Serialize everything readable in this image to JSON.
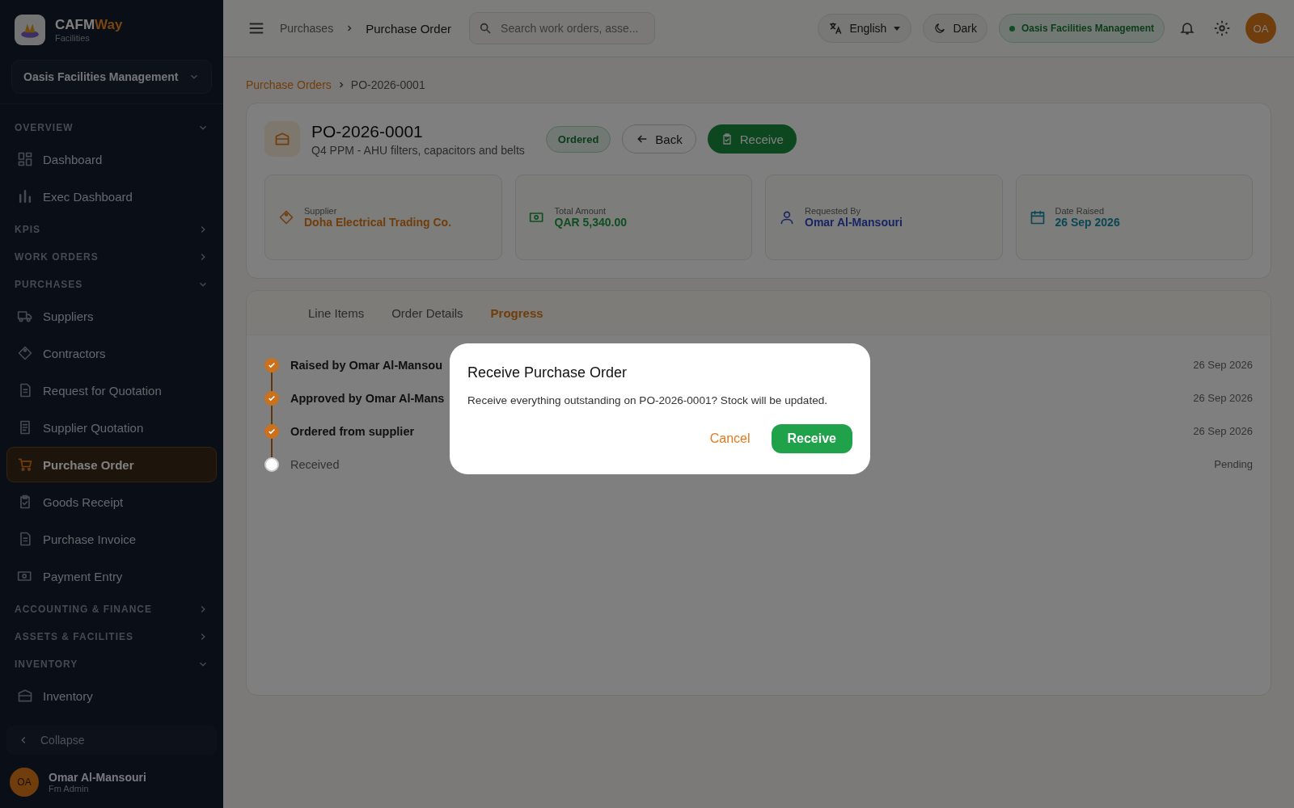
{
  "sidebar": {
    "brand": {
      "name_part1": "CAFM",
      "name_part2": "Way",
      "subtitle": "Facilities"
    },
    "org_selector": "Oasis Facilities Management",
    "sections": [
      {
        "title": "OVERVIEW",
        "expanded": true,
        "items": [
          {
            "label": "Dashboard",
            "selected": false
          },
          {
            "label": "Exec Dashboard",
            "selected": false
          }
        ]
      },
      {
        "title": "KPIS",
        "expanded": false
      },
      {
        "title": "WORK ORDERS",
        "expanded": false
      },
      {
        "title": "PURCHASES",
        "expanded": true,
        "items": [
          {
            "label": "Suppliers",
            "selected": false
          },
          {
            "label": "Contractors",
            "selected": false
          },
          {
            "label": "Request for Quotation",
            "selected": false
          },
          {
            "label": "Supplier Quotation",
            "selected": false
          },
          {
            "label": "Purchase Order",
            "selected": true
          },
          {
            "label": "Goods Receipt",
            "selected": false
          },
          {
            "label": "Purchase Invoice",
            "selected": false
          },
          {
            "label": "Payment Entry",
            "selected": false
          }
        ]
      },
      {
        "title": "ACCOUNTING & FINANCE",
        "expanded": false
      },
      {
        "title": "ASSETS & FACILITIES",
        "expanded": false
      },
      {
        "title": "INVENTORY",
        "expanded": true,
        "items": [
          {
            "label": "Inventory",
            "selected": false
          }
        ]
      }
    ],
    "collapse": "Collapse",
    "user": {
      "initials": "OA",
      "name": "Omar Al-Mansouri",
      "role": "Fm Admin"
    }
  },
  "topbar": {
    "breadcrumb": [
      "Purchases",
      "Purchase Order"
    ],
    "search": {
      "placeholder": "Search work orders, asse..."
    },
    "language": "English",
    "theme": "Dark",
    "org": "Oasis Facilities Management",
    "avatar": "OA"
  },
  "page_breadcrumb": [
    "Purchase Orders",
    "PO-2026-0001"
  ],
  "order": {
    "number": "PO-2026-0001",
    "description": "Q4 PPM - AHU filters, capacitors and belts",
    "status": "Ordered",
    "back": "Back",
    "receive": "Receive",
    "info": [
      {
        "label": "Supplier",
        "value": "Doha Electrical Trading Co."
      },
      {
        "label": "Total Amount",
        "value": "QAR 5,340.00"
      },
      {
        "label": "Requested By",
        "value": "Omar Al-Mansouri"
      },
      {
        "label": "Date Raised",
        "value": "26 Sep 2026"
      }
    ]
  },
  "tabs": [
    {
      "label": "Line Items",
      "selected": false
    },
    {
      "label": "Order Details",
      "selected": false
    },
    {
      "label": "Progress",
      "selected": true
    }
  ],
  "progress": [
    {
      "title": "Raised by Omar Al-Mansou",
      "date": "26 Sep 2026",
      "done": true
    },
    {
      "title": "Approved by Omar Al-Mans",
      "date": "26 Sep 2026",
      "done": true
    },
    {
      "title": "Ordered from supplier",
      "date": "26 Sep 2026",
      "done": true
    },
    {
      "title": "Received",
      "date": "Pending",
      "done": false
    }
  ],
  "dialog": {
    "title": "Receive Purchase Order",
    "message": "Receive everything outstanding on PO-2026-0001? Stock will be updated.",
    "cancel": "Cancel",
    "confirm": "Receive"
  }
}
